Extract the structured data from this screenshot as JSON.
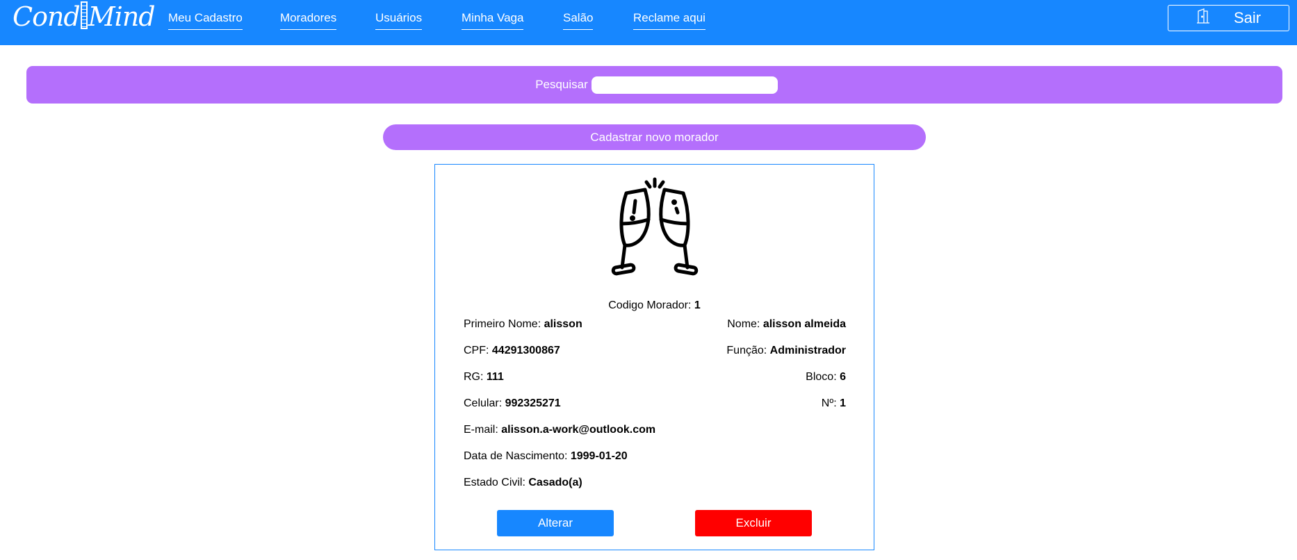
{
  "brand": {
    "name_left": "Cond",
    "name_right": "Mind"
  },
  "nav": {
    "items": [
      {
        "label": "Meu Cadastro"
      },
      {
        "label": "Moradores"
      },
      {
        "label": "Usuários"
      },
      {
        "label": "Minha Vaga"
      },
      {
        "label": "Salão"
      },
      {
        "label": "Reclame aqui"
      }
    ],
    "logout_label": "Sair"
  },
  "search": {
    "label": "Pesquisar",
    "value": ""
  },
  "actions": {
    "new_resident": "Cadastrar novo morador"
  },
  "resident": {
    "icon": "champagne-toast-icon",
    "codigo": {
      "label": "Codigo Morador: ",
      "value": "1"
    },
    "primeiro_nome": {
      "label": "Primeiro Nome: ",
      "value": "alisson"
    },
    "nome": {
      "label": "Nome: ",
      "value": "alisson almeida"
    },
    "cpf": {
      "label": "CPF: ",
      "value": "44291300867"
    },
    "funcao": {
      "label": "Função: ",
      "value": "Administrador"
    },
    "rg": {
      "label": "RG: ",
      "value": "111"
    },
    "bloco": {
      "label": "Bloco: ",
      "value": "6"
    },
    "celular": {
      "label": "Celular: ",
      "value": "992325271"
    },
    "numero": {
      "label": "Nº: ",
      "value": "1"
    },
    "email": {
      "label": "E-mail: ",
      "value": "alisson.a-work@outlook.com"
    },
    "nascimento": {
      "label": "Data de Nascimento: ",
      "value": "1999-01-20"
    },
    "estado_civil": {
      "label": "Estado Civil: ",
      "value": "Casado(a)"
    }
  },
  "buttons": {
    "edit": "Alterar",
    "delete": "Excluir"
  },
  "colors": {
    "primary": "#1787ff",
    "accent": "#b46ffc",
    "danger": "#ff0000"
  }
}
